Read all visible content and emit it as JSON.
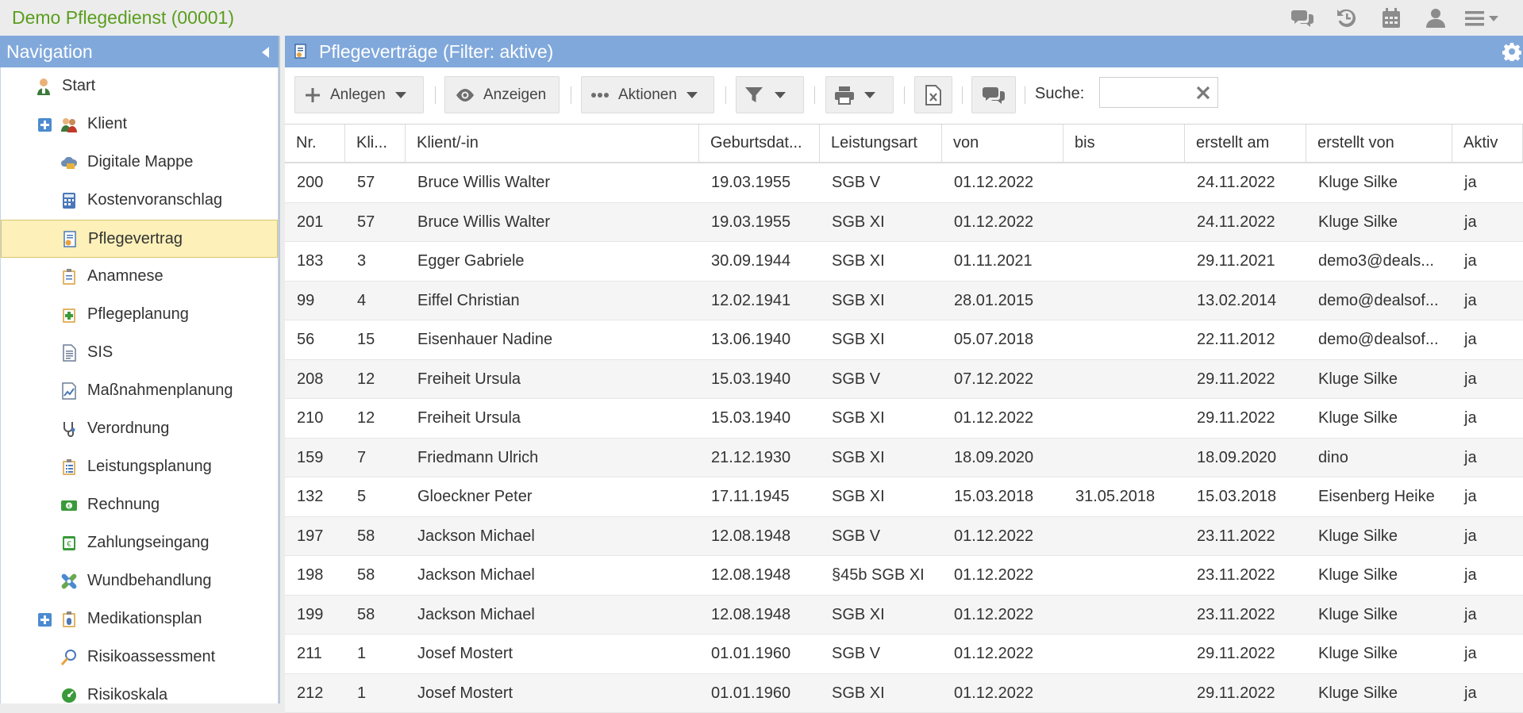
{
  "app": {
    "title": "Demo Pflegedienst (00001)"
  },
  "topbar": {
    "icons": [
      "chat-icon",
      "history-icon",
      "calendar-icon",
      "user-icon",
      "menu-icon"
    ]
  },
  "nav": {
    "title": "Navigation",
    "items": [
      {
        "label": "Start",
        "icon": "start-icon",
        "expandable": false
      },
      {
        "label": "Klient",
        "icon": "clients-icon",
        "expandable": true
      },
      {
        "label": "Digitale Mappe",
        "icon": "cloud-folder-icon",
        "expandable": false
      },
      {
        "label": "Kostenvoranschlag",
        "icon": "calculator-icon",
        "expandable": false
      },
      {
        "label": "Pflegevertrag",
        "icon": "contract-icon",
        "expandable": false,
        "active": true
      },
      {
        "label": "Anamnese",
        "icon": "clipboard-icon",
        "expandable": false
      },
      {
        "label": "Pflegeplanung",
        "icon": "care-plan-icon",
        "expandable": false
      },
      {
        "label": "SIS",
        "icon": "document-icon",
        "expandable": false
      },
      {
        "label": "Maßnahmenplanung",
        "icon": "chart-doc-icon",
        "expandable": false
      },
      {
        "label": "Verordnung",
        "icon": "stethoscope-icon",
        "expandable": false
      },
      {
        "label": "Leistungsplanung",
        "icon": "list-clipboard-icon",
        "expandable": false
      },
      {
        "label": "Rechnung",
        "icon": "invoice-icon",
        "expandable": false
      },
      {
        "label": "Zahlungseingang",
        "icon": "payment-icon",
        "expandable": false
      },
      {
        "label": "Wundbehandlung",
        "icon": "bandage-icon",
        "expandable": false
      },
      {
        "label": "Medikationsplan",
        "icon": "medication-icon",
        "expandable": true
      },
      {
        "label": "Risikoassessment",
        "icon": "magnifier-icon",
        "expandable": false
      },
      {
        "label": "Risikoskala",
        "icon": "scale-icon",
        "expandable": false
      }
    ]
  },
  "main": {
    "title": "Pflegeverträge (Filter: aktive)",
    "toolbar": {
      "create_label": "Anlegen",
      "show_label": "Anzeigen",
      "actions_label": "Aktionen",
      "search_label": "Suche:",
      "search_value": ""
    },
    "columns": [
      "Nr.",
      "Kli...",
      "Klient/-in",
      "Geburtsdat...",
      "Leistungsart",
      "von",
      "bis",
      "erstellt am",
      "erstellt von",
      "Aktiv"
    ],
    "rows": [
      [
        "200",
        "57",
        "Bruce Willis Walter",
        "19.03.1955",
        "SGB V",
        "01.12.2022",
        "",
        "24.11.2022",
        "Kluge Silke",
        "ja"
      ],
      [
        "201",
        "57",
        "Bruce Willis Walter",
        "19.03.1955",
        "SGB XI",
        "01.12.2022",
        "",
        "24.11.2022",
        "Kluge Silke",
        "ja"
      ],
      [
        "183",
        "3",
        "Egger Gabriele",
        "30.09.1944",
        "SGB XI",
        "01.11.2021",
        "",
        "29.11.2021",
        "demo3@deals...",
        "ja"
      ],
      [
        "99",
        "4",
        "Eiffel Christian",
        "12.02.1941",
        "SGB XI",
        "28.01.2015",
        "",
        "13.02.2014",
        "demo@dealsof...",
        "ja"
      ],
      [
        "56",
        "15",
        "Eisenhauer Nadine",
        "13.06.1940",
        "SGB XI",
        "05.07.2018",
        "",
        "22.11.2012",
        "demo@dealsof...",
        "ja"
      ],
      [
        "208",
        "12",
        "Freiheit Ursula",
        "15.03.1940",
        "SGB V",
        "07.12.2022",
        "",
        "29.11.2022",
        "Kluge Silke",
        "ja"
      ],
      [
        "210",
        "12",
        "Freiheit Ursula",
        "15.03.1940",
        "SGB XI",
        "01.12.2022",
        "",
        "29.11.2022",
        "Kluge Silke",
        "ja"
      ],
      [
        "159",
        "7",
        "Friedmann Ulrich",
        "21.12.1930",
        "SGB XI",
        "18.09.2020",
        "",
        "18.09.2020",
        "dino",
        "ja"
      ],
      [
        "132",
        "5",
        "Gloeckner Peter",
        "17.11.1945",
        "SGB XI",
        "15.03.2018",
        "31.05.2018",
        "15.03.2018",
        "Eisenberg Heike",
        "ja"
      ],
      [
        "197",
        "58",
        "Jackson Michael",
        "12.08.1948",
        "SGB V",
        "01.12.2022",
        "",
        "23.11.2022",
        "Kluge Silke",
        "ja"
      ],
      [
        "198",
        "58",
        "Jackson Michael",
        "12.08.1948",
        "§45b SGB XI",
        "01.12.2022",
        "",
        "23.11.2022",
        "Kluge Silke",
        "ja"
      ],
      [
        "199",
        "58",
        "Jackson Michael",
        "12.08.1948",
        "SGB XI",
        "01.12.2022",
        "",
        "23.11.2022",
        "Kluge Silke",
        "ja"
      ],
      [
        "211",
        "1",
        "Josef Mostert",
        "01.01.1960",
        "SGB V",
        "01.12.2022",
        "",
        "29.11.2022",
        "Kluge Silke",
        "ja"
      ],
      [
        "212",
        "1",
        "Josef Mostert",
        "01.01.1960",
        "SGB XI",
        "01.12.2022",
        "",
        "29.11.2022",
        "Kluge Silke",
        "ja"
      ]
    ]
  },
  "colors": {
    "header_blue": "#80a8db",
    "title_green": "#5a9e1e",
    "active_nav": "#fdf0b8"
  }
}
